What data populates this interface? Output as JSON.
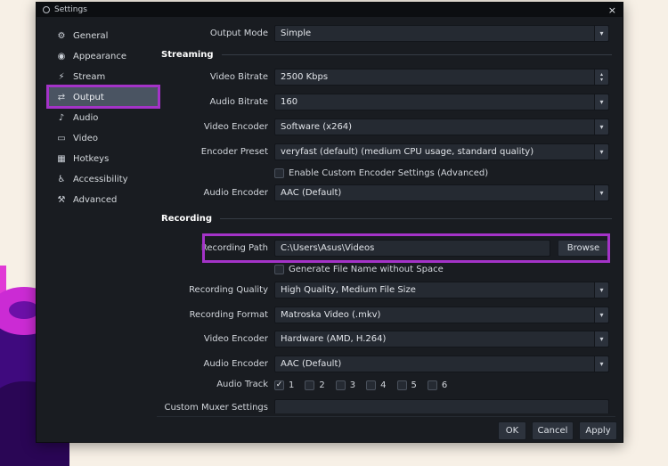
{
  "colors": {
    "annotation_highlight": "#a433c8",
    "selected_sidebar_bg": "#4a5462",
    "window_bg": "#191c21"
  },
  "window": {
    "title": "Settings",
    "close_icon": "×"
  },
  "icons": {
    "check": "✓",
    "caret_down": "▾",
    "caret_up": "▴"
  },
  "sidebar": {
    "selected": "Output",
    "items": [
      {
        "label": "General",
        "icon_glyph": "⚙"
      },
      {
        "label": "Appearance",
        "icon_glyph": "◉"
      },
      {
        "label": "Stream",
        "icon_glyph": "⚡"
      },
      {
        "label": "Output",
        "icon_glyph": "⇄"
      },
      {
        "label": "Audio",
        "icon_glyph": "♪"
      },
      {
        "label": "Video",
        "icon_glyph": "▭"
      },
      {
        "label": "Hotkeys",
        "icon_glyph": "▦"
      },
      {
        "label": "Accessibility",
        "icon_glyph": "♿"
      },
      {
        "label": "Advanced",
        "icon_glyph": "⚒"
      }
    ]
  },
  "content": {
    "output_mode": {
      "label": "Output Mode",
      "value": "Simple"
    },
    "streaming": {
      "header": "Streaming",
      "video_bitrate": {
        "label": "Video Bitrate",
        "value": "2500 Kbps"
      },
      "audio_bitrate": {
        "label": "Audio Bitrate",
        "value": "160"
      },
      "video_encoder": {
        "label": "Video Encoder",
        "value": "Software (x264)"
      },
      "encoder_preset": {
        "label": "Encoder Preset",
        "value": "veryfast (default) (medium CPU usage, standard quality)"
      },
      "enable_custom_encoder": {
        "label": "Enable Custom Encoder Settings (Advanced)",
        "checked": false
      },
      "audio_encoder": {
        "label": "Audio Encoder",
        "value": "AAC (Default)"
      }
    },
    "recording": {
      "header": "Recording",
      "recording_path": {
        "label": "Recording Path",
        "value": "C:\\Users\\Asus\\Videos",
        "browse_label": "Browse"
      },
      "generate_no_space": {
        "label": "Generate File Name without Space",
        "checked": false
      },
      "recording_quality": {
        "label": "Recording Quality",
        "value": "High Quality, Medium File Size"
      },
      "recording_format": {
        "label": "Recording Format",
        "value": "Matroska Video (.mkv)"
      },
      "video_encoder": {
        "label": "Video Encoder",
        "value": "Hardware (AMD, H.264)"
      },
      "audio_encoder": {
        "label": "Audio Encoder",
        "value": "AAC (Default)"
      },
      "audio_track": {
        "label": "Audio Track",
        "tracks": [
          "1",
          "2",
          "3",
          "4",
          "5",
          "6"
        ],
        "checked_track": "1"
      },
      "custom_muxer": {
        "label": "Custom Muxer Settings",
        "value": ""
      }
    }
  },
  "footer": {
    "ok": "OK",
    "cancel": "Cancel",
    "apply": "Apply"
  }
}
